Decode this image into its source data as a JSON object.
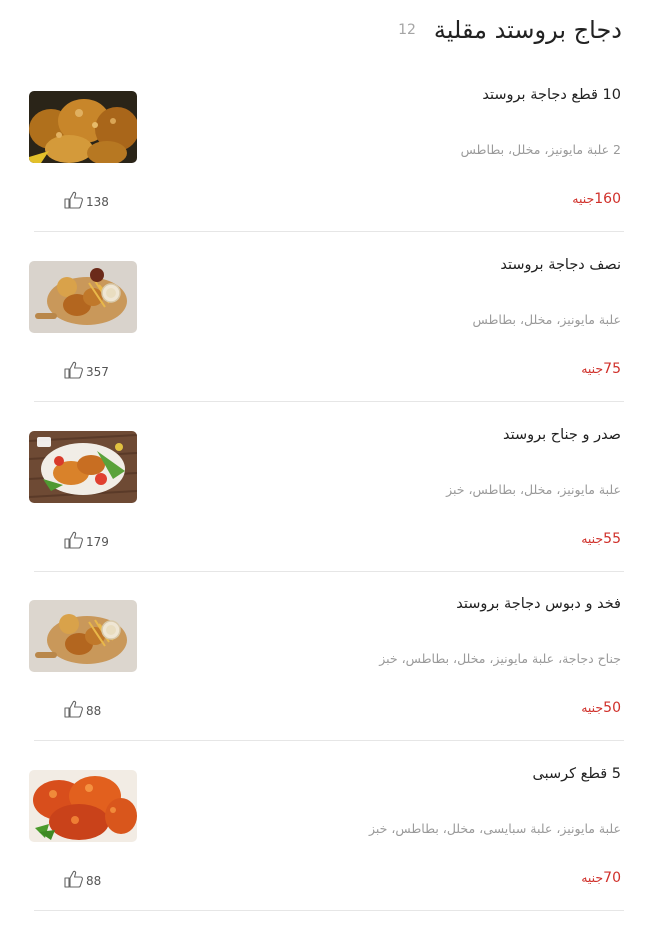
{
  "category": {
    "title": "دجاج بروستد مقلية",
    "count": "12"
  },
  "items": [
    {
      "name": "10 قطع دجاجة بروستد",
      "desc": "2 علبة مايونيز، مخلل، بطاطس",
      "price": "160",
      "currency": "جنيه",
      "likes": "138",
      "thumb": "fried-chicken-pieces"
    },
    {
      "name": "نصف دجاجة بروستد",
      "desc": "علبة مايونيز، مخلل، بطاطس",
      "price": "75",
      "currency": "جنيه",
      "likes": "357",
      "thumb": "chicken-board-plate"
    },
    {
      "name": "صدر و جناح بروستد",
      "desc": "علبة مايونيز، مخلل، بطاطس، خبز",
      "price": "55",
      "currency": "جنيه",
      "likes": "179",
      "thumb": "chicken-salad-plate"
    },
    {
      "name": "فخد و دبوس دجاجة بروستد",
      "desc": "جناح دجاجة، علبة مايونيز، مخلل، بطاطس، خبز",
      "price": "50",
      "currency": "جنيه",
      "likes": "88",
      "thumb": "chicken-board-plate"
    },
    {
      "name": "5 قطع كرسبى",
      "desc": "علبة مايونيز، علبة سبايسى، مخلل، بطاطس، خبز",
      "price": "70",
      "currency": "جنيه",
      "likes": "88",
      "thumb": "crispy-chicken"
    }
  ],
  "colors": {
    "price": "#d0302a",
    "text": "#222222",
    "muted": "#9a9a9a",
    "divider": "#e6e6e6"
  }
}
